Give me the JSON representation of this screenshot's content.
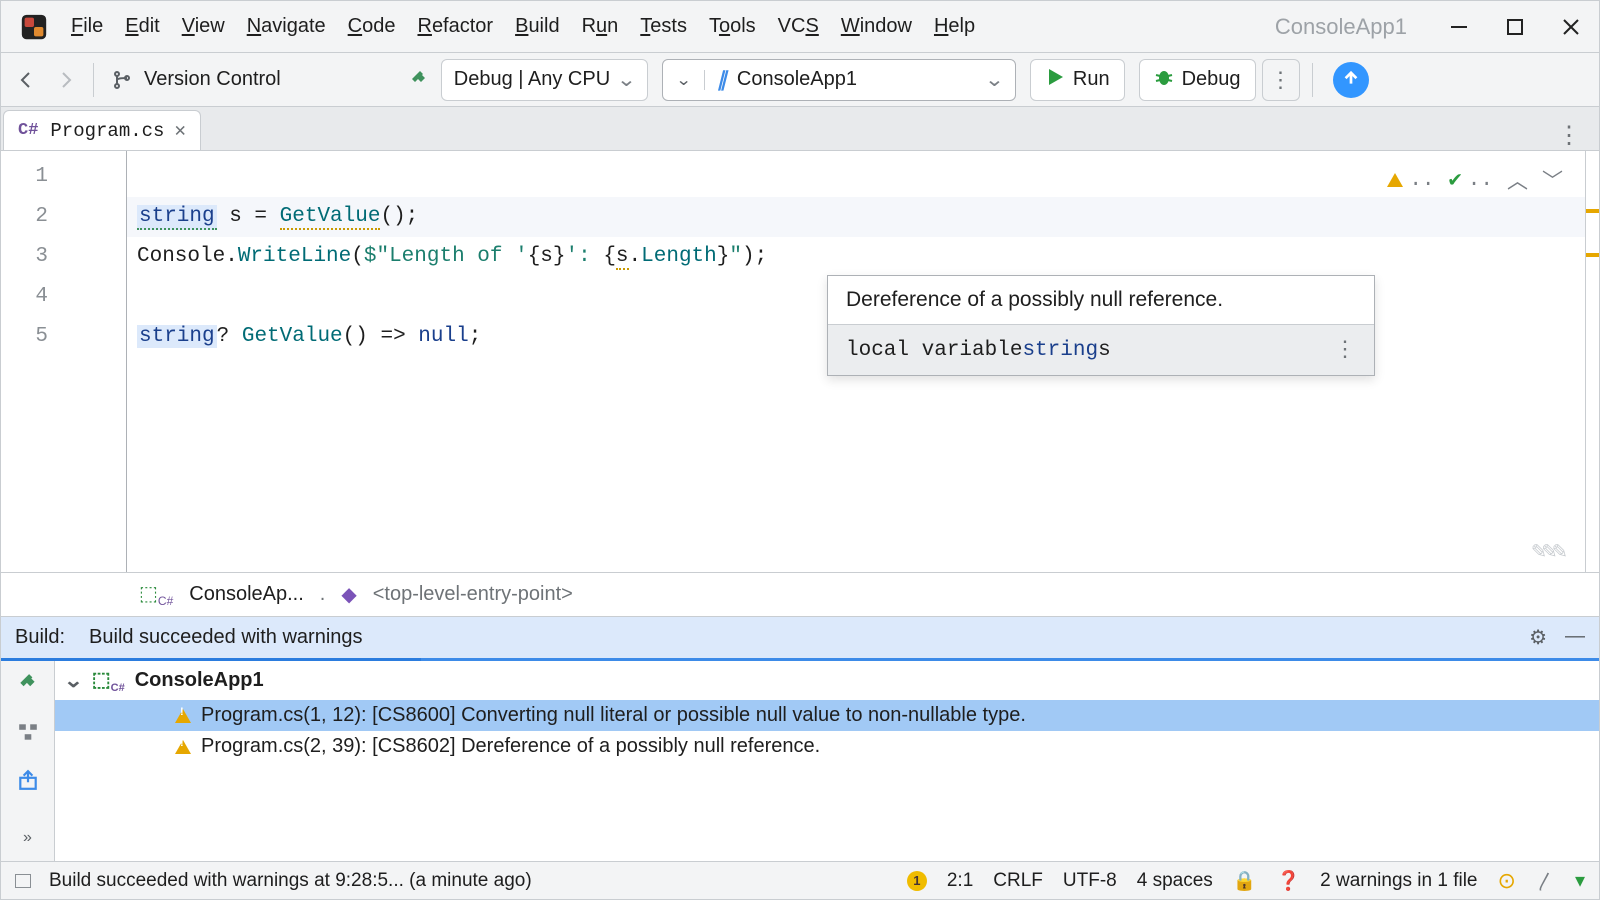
{
  "title": {
    "project_name": "ConsoleApp1"
  },
  "menus": {
    "items": [
      {
        "label": "File",
        "u": "F",
        "rest": "ile"
      },
      {
        "label": "Edit",
        "u": "E",
        "rest": "dit"
      },
      {
        "label": "View",
        "u": "V",
        "rest": "iew"
      },
      {
        "label": "Navigate",
        "u": "N",
        "rest": "avigate"
      },
      {
        "label": "Code",
        "u": "C",
        "rest": "ode"
      },
      {
        "label": "Refactor",
        "u": "R",
        "rest": "efactor"
      },
      {
        "label": "Build",
        "u": "B",
        "rest": "uild"
      },
      {
        "label": "Run",
        "u": "",
        "rest": "R",
        "u2": "u",
        "rest2": "n"
      },
      {
        "label": "Tests",
        "u": "T",
        "rest": "ests"
      },
      {
        "label": "Tools",
        "u": "",
        "rest": "T",
        "u2": "o",
        "rest2": "ols"
      },
      {
        "label": "VCS",
        "u": "",
        "rest": "VC",
        "u2": "S",
        "rest2": ""
      },
      {
        "label": "Window",
        "u": "W",
        "rest": "indow"
      },
      {
        "label": "Help",
        "u": "H",
        "rest": "elp"
      }
    ]
  },
  "toolbar": {
    "vcs_label": "Version Control",
    "build_config": "Debug | Any CPU",
    "run_config": "ConsoleApp1",
    "run_label": "Run",
    "debug_label": "Debug"
  },
  "tab": {
    "filename": "Program.cs",
    "lang_badge": "C#"
  },
  "editor": {
    "lines": [
      "1",
      "2",
      "3",
      "4",
      "5"
    ],
    "code": {
      "l2_kw": "string",
      "l2_rest": " s = ",
      "l2_call": "GetValue",
      "l2_tail": "();",
      "l3_a": "Console",
      "l3_b": ".",
      "l3_c": "WriteLine",
      "l3_d": "(",
      "l3_e": "$\"Length of '",
      "l3_f": "{s}",
      "l3_g": "': ",
      "l3_h": "{",
      "l3_i": "s",
      "l3_j": ".",
      "l3_k": "Length",
      "l3_l": "}",
      "l3_m": "\"",
      "l3_n": ");",
      "l5_kw": "string",
      "l5_q": "?",
      "l5_rest": " ",
      "l5_call": "GetValue",
      "l5_tail": "() => ",
      "l5_null": "null",
      "l5_semi": ";"
    },
    "hint": {
      "title": "Dereference of a possibly null reference.",
      "kind": "local variable ",
      "type": "string",
      "var": " s"
    }
  },
  "breadcrumbs": {
    "project": "ConsoleAp...",
    "dots": " .",
    "method": "<top-level-entry-point>"
  },
  "build": {
    "head_label": "Build:",
    "head_status": "Build succeeded with warnings",
    "project": "ConsoleApp1",
    "warnings": [
      "Program.cs(1, 12): [CS8600] Converting null literal or possible null value to non-nullable type.",
      "Program.cs(2, 39): [CS8602] Dereference of a possibly null reference."
    ]
  },
  "status": {
    "build_msg": "Build succeeded with warnings at 9:28:5... (a minute ago)",
    "issues_badge": "1",
    "caret": "2:1",
    "eol": "CRLF",
    "encoding": "UTF-8",
    "indent": "4 spaces",
    "warnings_text": "2 warnings in 1 file"
  }
}
